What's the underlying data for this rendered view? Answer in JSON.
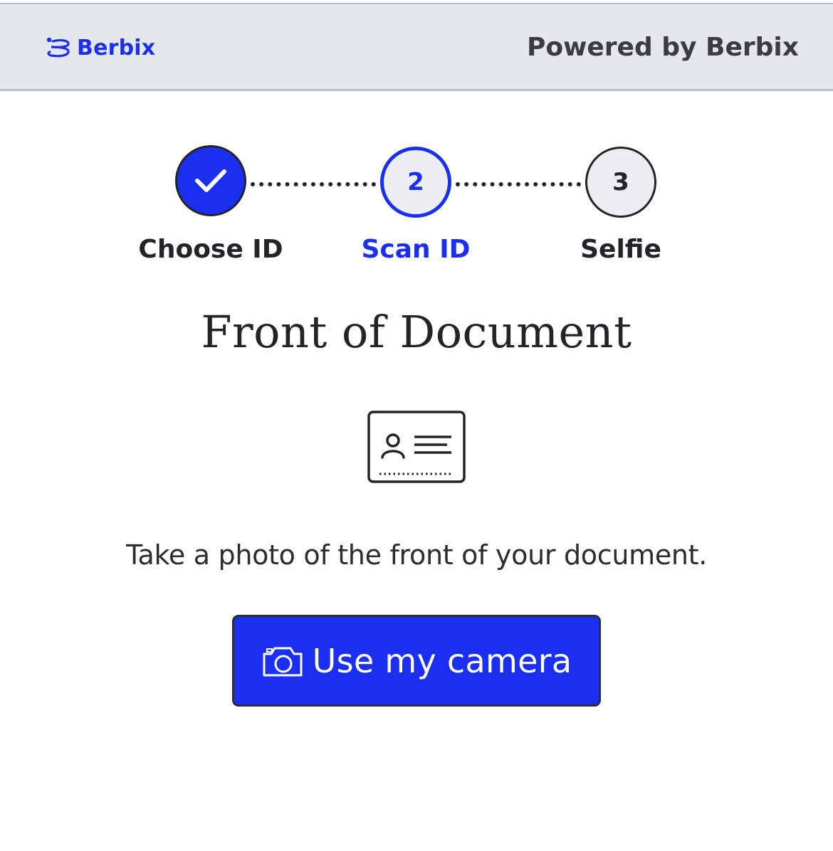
{
  "header": {
    "logo_text": "Berbix",
    "powered_by": "Powered by Berbix"
  },
  "stepper": {
    "steps": [
      {
        "number": "1",
        "label": "Choose ID",
        "status": "complete"
      },
      {
        "number": "2",
        "label": "Scan ID",
        "status": "current"
      },
      {
        "number": "3",
        "label": "Selfie",
        "status": "upcoming"
      }
    ]
  },
  "main": {
    "title": "Front of Document",
    "instruction": "Take a photo of the front of your document.",
    "camera_button_label": "Use my camera"
  },
  "icons": {
    "logo": "berbix-logo-icon",
    "step_complete": "check-icon",
    "document": "id-card-icon",
    "camera": "camera-icon"
  },
  "colors": {
    "accent": "#1a2ff0",
    "header_bg": "#e4e7ec",
    "text": "#222428",
    "button_text": "#ffffff"
  }
}
